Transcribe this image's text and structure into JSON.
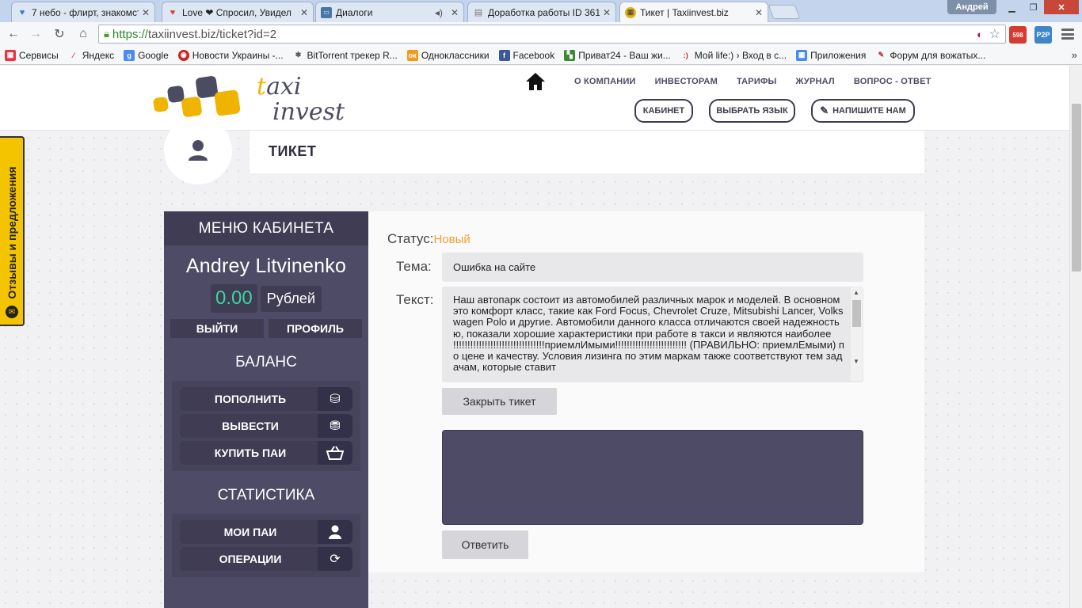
{
  "browser": {
    "tabs": [
      {
        "title": "7 небо - флирт, знакомст",
        "icon": "heart-shield-icon"
      },
      {
        "title": "Love ❤ Спросил, Увидел",
        "icon": "heart-icon"
      },
      {
        "title": "Диалоги",
        "icon": "vk-icon"
      },
      {
        "title": "Доработка работы ID 361",
        "icon": "page-icon"
      },
      {
        "title": "Тикет | Taxiinvest.biz",
        "icon": "taxi-checker-icon"
      }
    ],
    "user": "Андрей",
    "url_scheme": "https://",
    "url_rest": "taxiinvest.biz/ticket?id=2",
    "ext_mail_count": "598",
    "ext_p2p": "P2P",
    "bookmarks": [
      "Сервисы",
      "Яндекс",
      "Google",
      "Новости Украины -...",
      "BitTorrent трекер R...",
      "Одноклассники",
      "Facebook",
      "Приват24 - Ваш жи...",
      "Мой life:) › Вход в с...",
      "Приложения",
      "Форум для вожатых..."
    ],
    "bookmarks_more": "»"
  },
  "header": {
    "logo_line1_accent": "t",
    "logo_line1": "axi",
    "logo_line2": "invest",
    "nav": [
      "О КОМПАНИИ",
      "ИНВЕСТОРАМ",
      "ТАРИФЫ",
      "ЖУРНАЛ",
      "ВОПРОС - ОТВЕТ"
    ],
    "btn_cabinet": "КАБИНЕТ",
    "btn_language": "ВЫБРАТЬ ЯЗЫК",
    "btn_write": "НАПИШИТЕ НАМ"
  },
  "feedback_tab": "Отзывы и предложения",
  "page_title": "ТИКЕТ",
  "sidebar": {
    "title": "МЕНЮ КАБИНЕТА",
    "user_name": "Andrey Litvinenko",
    "balance": "0.00",
    "currency": "Рублей",
    "logout": "ВЫЙТИ",
    "profile": "ПРОФИЛЬ",
    "balance_section": "БАЛАНС",
    "balance_items": [
      {
        "label": "ПОПОЛНИТЬ",
        "icon": "deposit-coins-icon"
      },
      {
        "label": "ВЫВЕСТИ",
        "icon": "withdraw-coins-icon"
      },
      {
        "label": "КУПИТЬ ПАИ",
        "icon": "basket-icon"
      }
    ],
    "stats_section": "СТАТИСТИКА",
    "stats_items": [
      {
        "label": "МОИ ПАИ",
        "icon": "user-icon"
      },
      {
        "label": "ОПЕРАЦИИ",
        "icon": "refresh-icon"
      }
    ]
  },
  "ticket": {
    "status_label": "Статус:",
    "status_value": "Новый",
    "subject_label": "Тема:",
    "subject_value": "Ошибка на сайте",
    "text_label": "Текст:",
    "text_value": "Наш автопарк состоит из автомобилей различных марок и моделей. В основном это комфорт класс, такие как Ford Focus, Chevrolet Cruze, Mitsubishi Lancer, Volkswagen Polo и другие. Автомобили данного класса отличаются своей надежностью, показали хорошие характеристики при работе в такси и являются наиболее !!!!!!!!!!!!!!!!!!!!!!!!!!!!!!!!приемлИмыми!!!!!!!!!!!!!!!!!!!!!!!!! (ПРАВИЛЬНО: приемлЕмыми) по цене и качеству. Условия лизинга по этим маркам также соответствуют тем задачам, которые ставит",
    "close_button": "Закрыть тикет",
    "reply_value": "",
    "reply_button": "Ответить"
  },
  "colors": {
    "sidebar": "#4e4b66",
    "accent_yellow": "#f0b400",
    "status_orange": "#f0a030",
    "balance_green": "#3fd3a0"
  }
}
